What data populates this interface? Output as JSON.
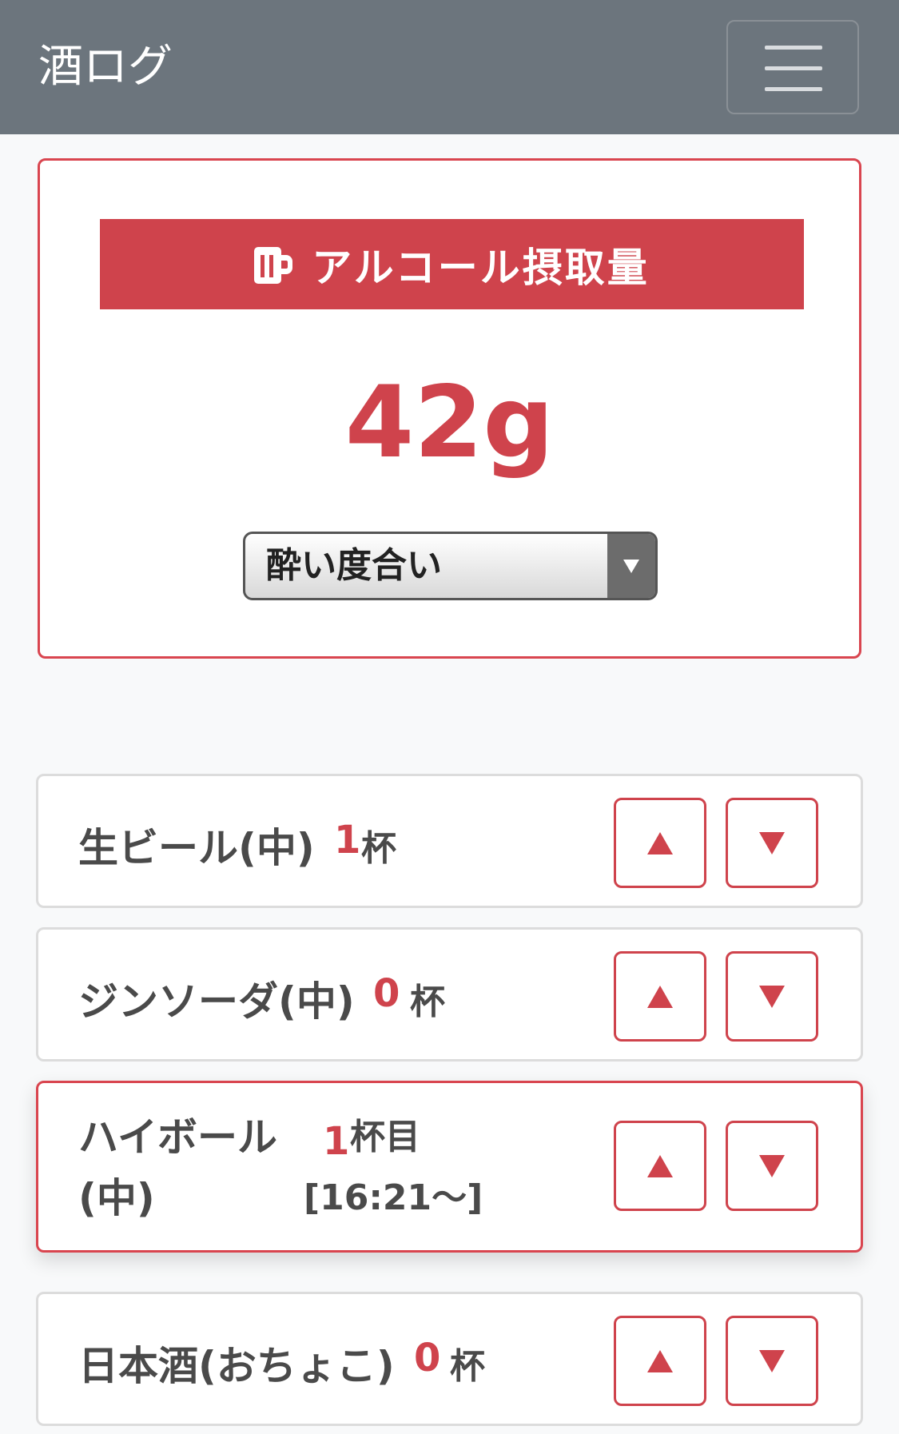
{
  "app": {
    "title": "酒ログ",
    "menu_icon": "hamburger-menu-icon"
  },
  "summary": {
    "icon": "beer-mug-icon",
    "title": "アルコール摂取量",
    "amount": "42g",
    "drunkenness_select": {
      "selected": "酔い度合い"
    }
  },
  "drinks": [
    {
      "name": "生ビール(中)",
      "count": "1",
      "unit": "杯"
    },
    {
      "name": "ジンソーダ(中)",
      "count": "0",
      "unit": "杯"
    },
    {
      "name": "ハイボール(中)",
      "count": "1",
      "unit": "杯目 [16:21〜]"
    },
    {
      "name": "日本酒(おちょこ)",
      "count": "0",
      "unit": "杯"
    }
  ],
  "colors": {
    "navbar": "#6c757d",
    "accent": "#cf434c",
    "background": "#f8f9fa"
  }
}
